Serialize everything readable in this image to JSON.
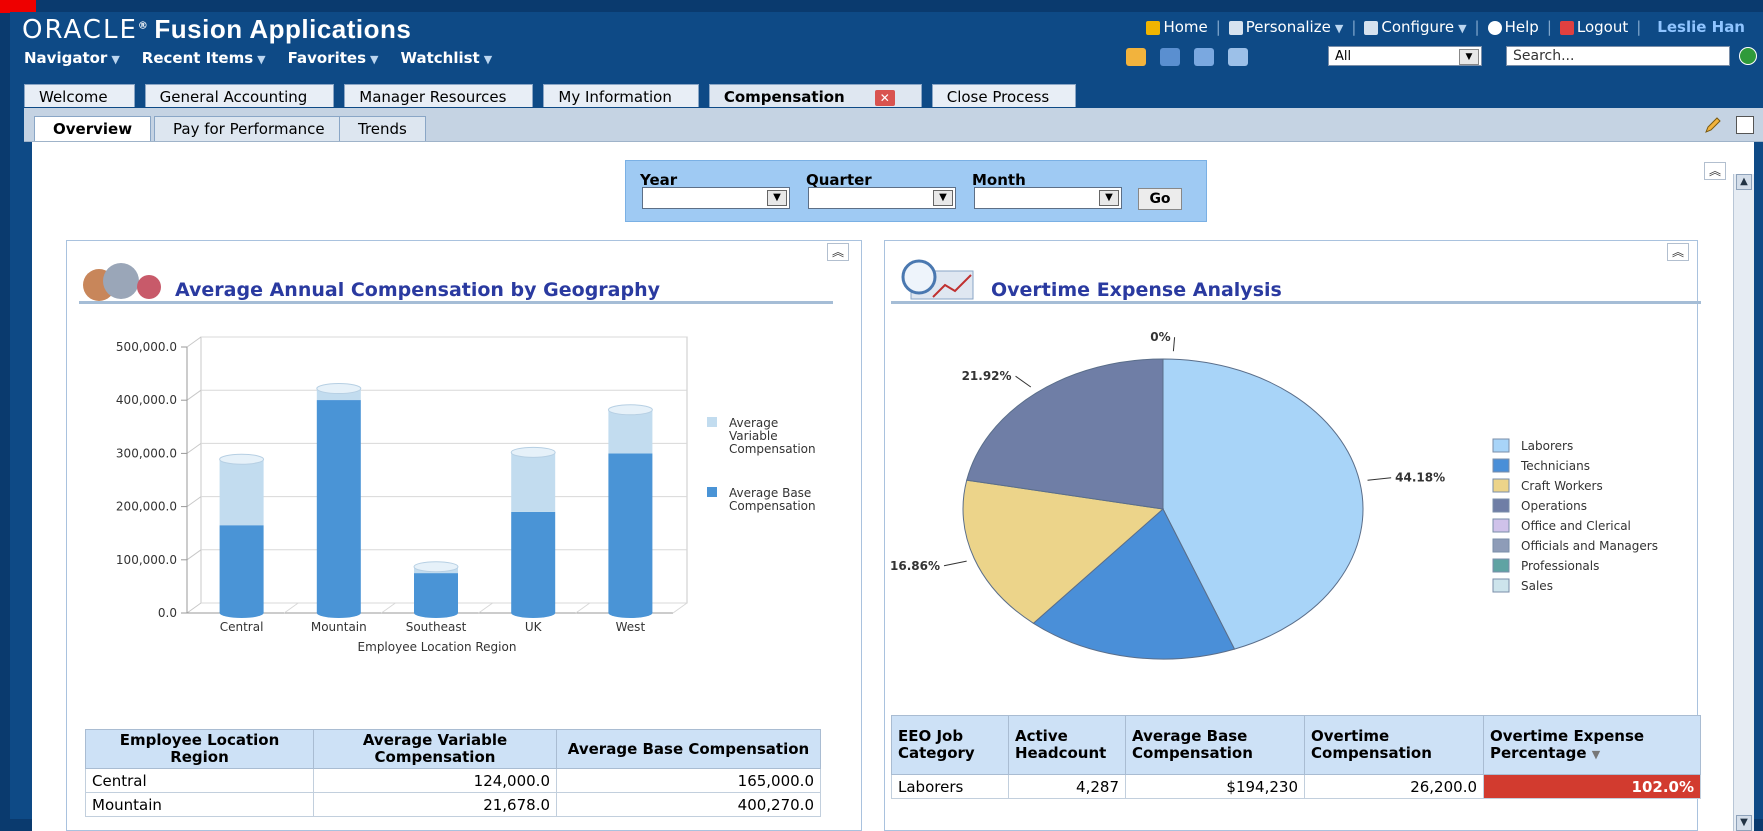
{
  "header": {
    "brand_oracle": "ORACLE",
    "brand_tm": "®",
    "brand_product": "Fusion Applications",
    "nav": [
      "Navigator",
      "Recent Items",
      "Favorites",
      "Watchlist"
    ],
    "global_links": {
      "home": "Home",
      "personalize": "Personalize",
      "configure": "Configure",
      "help": "Help",
      "logout": "Logout",
      "user": "Leslie Han"
    },
    "search_scope": "All",
    "search_placeholder": "Search..."
  },
  "tabs": [
    "Welcome",
    "General Accounting",
    "Manager Resources",
    "My Information",
    "Compensation",
    "Close Process"
  ],
  "active_tab": "Compensation",
  "subtabs": [
    "Overview",
    "Pay for Performance",
    "Trends"
  ],
  "active_subtab": "Overview",
  "filter": {
    "year_label": "Year",
    "quarter_label": "Quarter",
    "month_label": "Month",
    "go_label": "Go"
  },
  "geo_panel": {
    "title": "Average Annual Compensation by Geography",
    "table": {
      "headers": [
        "Employee Location Region",
        "Average Variable Compensation",
        "Average Base Compensation"
      ],
      "rows": [
        [
          "Central",
          "124,000.0",
          "165,000.0"
        ],
        [
          "Mountain",
          "21,678.0",
          "400,270.0"
        ]
      ]
    }
  },
  "overtime_panel": {
    "title": "Overtime Expense Analysis",
    "table": {
      "headers": [
        "EEO Job Category",
        "Active Headcount",
        "Average Base Compensation",
        "Overtime Compensation",
        "Overtime Expense Percentage"
      ],
      "rows": [
        [
          "Laborers",
          "4,287",
          "$194,230",
          "26,200.0",
          "102.0%"
        ]
      ]
    }
  },
  "chart_data": [
    {
      "type": "bar",
      "stacked": true,
      "title": "",
      "xlabel": "Employee Location Region",
      "ylabel": "",
      "categories": [
        "Central",
        "Mountain",
        "Southeast",
        "UK",
        "West"
      ],
      "ylim": [
        0,
        500000
      ],
      "yticks": [
        "0.0",
        "100,000.0",
        "200,000.0",
        "300,000.0",
        "400,000.0",
        "500,000.0"
      ],
      "series": [
        {
          "name": "Average Base Compensation",
          "values": [
            165000,
            400270,
            75000,
            190000,
            300000
          ],
          "color": "#4a94d6"
        },
        {
          "name": "Average Variable Compensation",
          "values": [
            124000,
            21678,
            12000,
            112000,
            82000
          ],
          "color": "#c2dcef"
        }
      ],
      "legend": [
        "Average Variable Compensation",
        "Average Base Compensation"
      ],
      "legend_position": "right",
      "grid": true
    },
    {
      "type": "pie",
      "title": "",
      "categories": [
        "Laborers",
        "Technicians",
        "Craft Workers",
        "Operations",
        "Office and Clerical",
        "Officials and Managers",
        "Professionals",
        "Sales"
      ],
      "values": [
        44.18,
        17.03,
        16.86,
        21.92,
        0,
        0,
        0,
        0
      ],
      "labels": [
        "44.18%",
        "17.03%",
        "16.86%",
        "21.92%",
        "0%"
      ],
      "colors": [
        "#a8d4f8",
        "#4a8fd8",
        "#ecd48a",
        "#6f7ea6",
        "#cfc2ea",
        "#8e9cb8",
        "#5fa3a3",
        "#cde4ec"
      ],
      "legend_position": "right"
    }
  ]
}
